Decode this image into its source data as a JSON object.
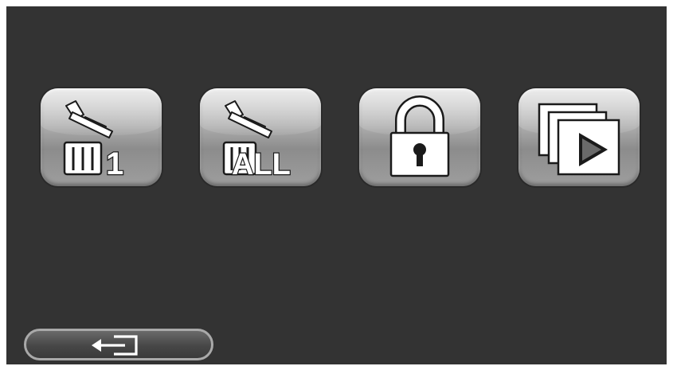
{
  "toolbar": {
    "delete_one": {
      "icon": "trash-single-icon",
      "label": "1"
    },
    "delete_all": {
      "icon": "trash-all-icon",
      "label": "ALL"
    },
    "protect": {
      "icon": "lock-icon"
    },
    "slideshow": {
      "icon": "slideshow-icon"
    }
  },
  "footer": {
    "back": {
      "icon": "return-arrow-icon"
    }
  },
  "colors": {
    "screen_bg": "#333333",
    "button_face": "#ababab",
    "glyph": "#ffffff"
  }
}
